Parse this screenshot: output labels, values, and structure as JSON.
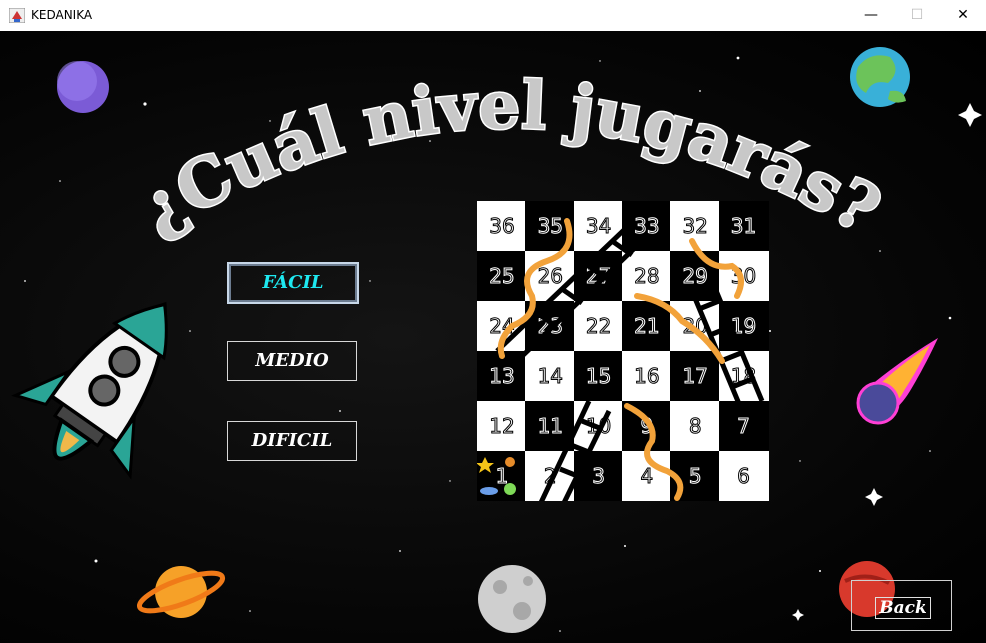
{
  "window": {
    "title": "KEDANIKA",
    "controls": {
      "minimize": "—",
      "maximize": "☐",
      "close": "✕"
    }
  },
  "heading": "¿Cuál nivel jugarás?",
  "menu": {
    "easy": "FÁCIL",
    "medium": "MEDIO",
    "hard": "DIFICIL",
    "selected": "easy"
  },
  "back_label": "Back",
  "board": {
    "rows": [
      [
        "36",
        "35",
        "34",
        "33",
        "32",
        "31"
      ],
      [
        "25",
        "26",
        "27",
        "28",
        "29",
        "30"
      ],
      [
        "24",
        "23",
        "22",
        "21",
        "20",
        "19"
      ],
      [
        "13",
        "14",
        "15",
        "16",
        "17",
        "18"
      ],
      [
        "12",
        "11",
        "10",
        "9",
        "8",
        "7"
      ],
      [
        "1",
        "2",
        "3",
        "4",
        "5",
        "6"
      ]
    ]
  },
  "colors": {
    "accent": "#1ee8f0",
    "board_dark": "#000000",
    "board_light": "#ffffff",
    "snake": "#f2a23a"
  },
  "icons": [
    "rocket-icon",
    "purple-planet-icon",
    "earth-planet-icon",
    "saturn-planet-icon",
    "moon-icon",
    "red-planet-icon",
    "comet-icon",
    "star-icon",
    "ufo-icon",
    "alien-icon"
  ]
}
